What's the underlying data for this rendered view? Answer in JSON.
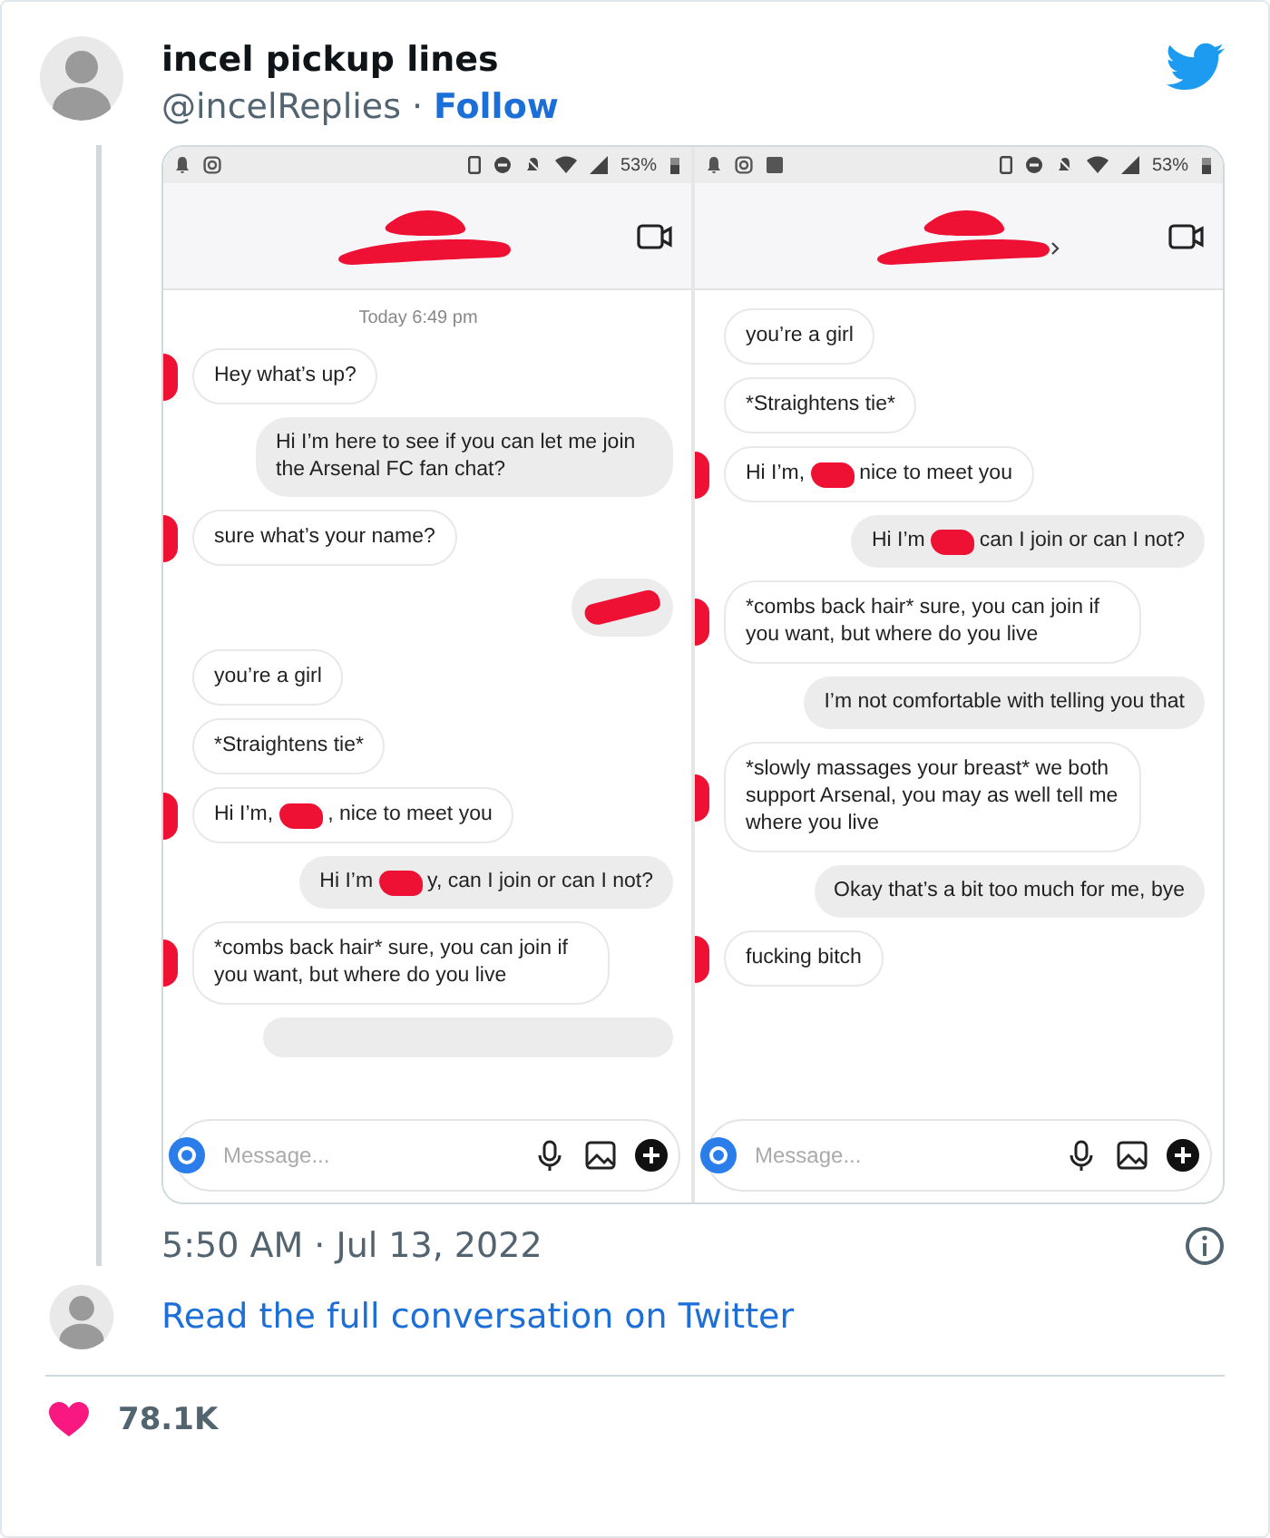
{
  "tweet": {
    "author": {
      "name": "incel pickup lines",
      "handle": "@incelReplies",
      "separator": "·",
      "follow": "Follow"
    },
    "screenshots": [
      {
        "gallery_icon": false,
        "battery": "53%",
        "title_chevron": false,
        "composer_placeholder": "Message...",
        "messages": [
          {
            "kind": "date",
            "text": "Today 6:49 pm"
          },
          {
            "kind": "received",
            "parts": [
              "Hey what’s up?"
            ],
            "avatar_redacted": true
          },
          {
            "kind": "sent",
            "parts": [
              "Hi I’m here to see if you can let me join the Arsenal FC fan chat?"
            ]
          },
          {
            "kind": "received",
            "parts": [
              "sure what’s your name?"
            ],
            "avatar_redacted": true
          },
          {
            "kind": "sent_redacted"
          },
          {
            "kind": "received",
            "parts": [
              "you’re a girl"
            ],
            "avatar_redacted": false
          },
          {
            "kind": "received",
            "parts": [
              "*Straightens tie*"
            ],
            "avatar_redacted": false
          },
          {
            "kind": "received",
            "parts": [
              "Hi I’m,",
              ", nice to meet you"
            ],
            "avatar_redacted": true
          },
          {
            "kind": "sent",
            "parts": [
              "Hi I’m",
              "y, can I join or can I not?"
            ]
          },
          {
            "kind": "received",
            "parts": [
              "*combs back hair* sure, you can join if you want, but where do you live"
            ],
            "avatar_redacted": true
          },
          {
            "kind": "sent_cut"
          }
        ]
      },
      {
        "gallery_icon": true,
        "battery": "53%",
        "title_chevron": true,
        "composer_placeholder": "Message...",
        "messages": [
          {
            "kind": "received",
            "parts": [
              "you’re a girl"
            ],
            "avatar_redacted": false
          },
          {
            "kind": "received",
            "parts": [
              "*Straightens tie*"
            ],
            "avatar_redacted": false
          },
          {
            "kind": "received",
            "parts": [
              "Hi I’m,",
              "nice to meet you"
            ],
            "avatar_redacted": true
          },
          {
            "kind": "sent",
            "parts": [
              "Hi I’m",
              "can I join or can I not?"
            ]
          },
          {
            "kind": "received",
            "parts": [
              "*combs back hair* sure, you can join if you want, but where do you live"
            ],
            "avatar_redacted": true
          },
          {
            "kind": "sent",
            "parts": [
              "I’m not comfortable with telling you that"
            ]
          },
          {
            "kind": "received",
            "parts": [
              "*slowly massages your breast* we both support Arsenal, you may as well tell me where you live"
            ],
            "avatar_redacted": true
          },
          {
            "kind": "sent",
            "parts": [
              "Okay that’s a bit too much for me, bye"
            ]
          },
          {
            "kind": "received",
            "parts": [
              "fucking bitch"
            ],
            "avatar_redacted": true
          }
        ]
      }
    ],
    "timestamp": "5:50 AM · Jul 13, 2022",
    "read_more": "Read the full conversation on Twitter",
    "likes": "78.1K"
  }
}
